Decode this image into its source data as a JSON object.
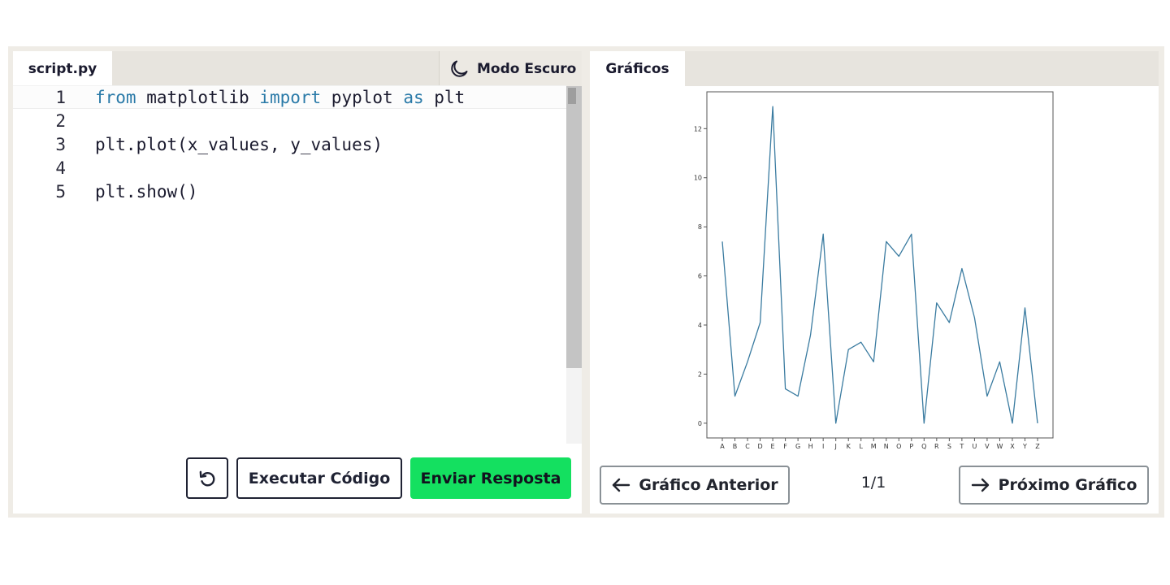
{
  "editor": {
    "tab_label": "script.py",
    "dark_mode_label": "Modo Escuro",
    "lines": [
      {
        "num": "1",
        "tokens": [
          {
            "t": "from",
            "kw": true
          },
          {
            "t": " matplotlib ",
            "kw": false
          },
          {
            "t": "import",
            "kw": true
          },
          {
            "t": " pyplot ",
            "kw": false
          },
          {
            "t": "as",
            "kw": true
          },
          {
            "t": " plt",
            "kw": false
          }
        ]
      },
      {
        "num": "2",
        "tokens": []
      },
      {
        "num": "3",
        "tokens": [
          {
            "t": "plt.plot(x_values, y_values)",
            "kw": false
          }
        ]
      },
      {
        "num": "4",
        "tokens": []
      },
      {
        "num": "5",
        "tokens": [
          {
            "t": "plt.show()",
            "kw": false
          }
        ]
      }
    ],
    "run_label": "Executar Código",
    "submit_label": "Enviar Resposta",
    "reset_icon": "reset-icon"
  },
  "charts": {
    "tab_label": "Gráficos",
    "prev_label": "Gráfico Anterior",
    "next_label": "Próximo Gráfico",
    "page_indicator": "1/1"
  },
  "colors": {
    "accent_green": "#14e060",
    "line_blue": "#3a7ba0",
    "keyword_blue": "#2a7aa8"
  },
  "chart_data": {
    "type": "line",
    "categories": [
      "A",
      "B",
      "C",
      "D",
      "E",
      "F",
      "G",
      "H",
      "I",
      "J",
      "K",
      "L",
      "M",
      "N",
      "O",
      "P",
      "Q",
      "R",
      "S",
      "T",
      "U",
      "V",
      "W",
      "X",
      "Y",
      "Z"
    ],
    "values": [
      7.4,
      1.1,
      2.5,
      4.1,
      12.9,
      1.4,
      1.1,
      3.6,
      7.7,
      0,
      3.0,
      3.3,
      2.5,
      7.4,
      6.8,
      7.7,
      0,
      4.9,
      4.1,
      6.3,
      4.3,
      1.1,
      2.5,
      0,
      4.7,
      0
    ],
    "ylim": [
      -0.6,
      13.5
    ],
    "yticks": [
      0,
      2,
      4,
      6,
      8,
      10,
      12
    ],
    "title": "",
    "xlabel": "",
    "ylabel": "",
    "grid": false
  }
}
